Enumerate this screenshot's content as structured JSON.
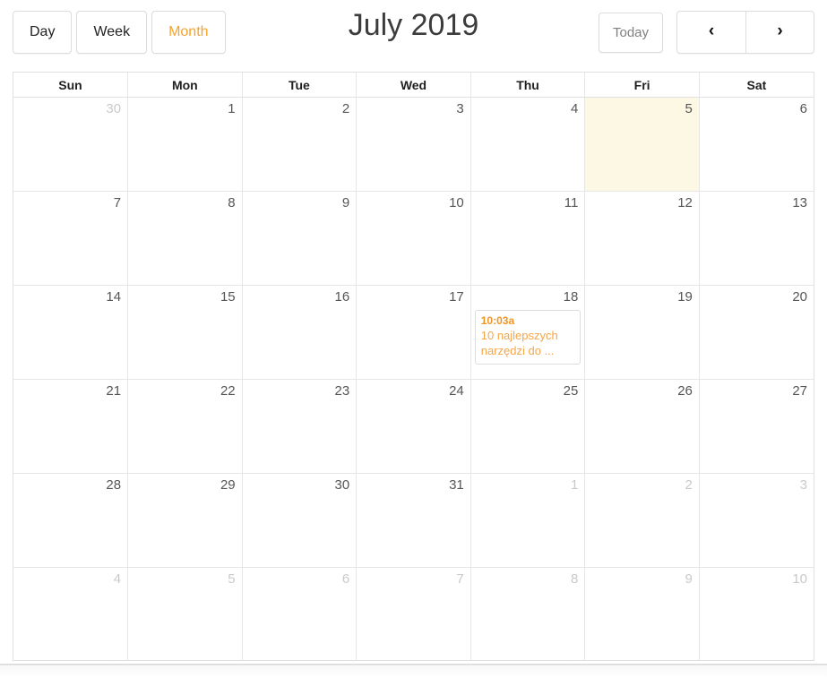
{
  "toolbar": {
    "views": [
      {
        "label": "Day",
        "state": "normal"
      },
      {
        "label": "Week",
        "state": "normal"
      },
      {
        "label": "Month",
        "state": "active"
      }
    ],
    "title": "July 2019",
    "today_label": "Today",
    "today_state": "disabled",
    "prev_icon": "chevron-left-icon",
    "prev_glyph": "‹",
    "next_icon": "chevron-right-icon",
    "next_glyph": "›"
  },
  "colors": {
    "accent": "#f6a32c",
    "event_time": "#ef9526",
    "event_title": "#f4a64a",
    "today_background": "#fcf8e3",
    "border": "#e0e0e0",
    "daynum": "#555555",
    "daynum_muted": "#c9c9c9"
  },
  "calendar": {
    "weekday_headers": [
      "Sun",
      "Mon",
      "Tue",
      "Wed",
      "Thu",
      "Fri",
      "Sat"
    ],
    "weeks": [
      [
        {
          "day": "30",
          "other_month": true
        },
        {
          "day": "1"
        },
        {
          "day": "2"
        },
        {
          "day": "3"
        },
        {
          "day": "4"
        },
        {
          "day": "5",
          "today": true
        },
        {
          "day": "6"
        }
      ],
      [
        {
          "day": "7"
        },
        {
          "day": "8"
        },
        {
          "day": "9"
        },
        {
          "day": "10"
        },
        {
          "day": "11"
        },
        {
          "day": "12"
        },
        {
          "day": "13"
        }
      ],
      [
        {
          "day": "14"
        },
        {
          "day": "15"
        },
        {
          "day": "16"
        },
        {
          "day": "17"
        },
        {
          "day": "18",
          "event": {
            "time": "10:03a",
            "title": "10 najlepszych narzędzi do ..."
          }
        },
        {
          "day": "19"
        },
        {
          "day": "20"
        }
      ],
      [
        {
          "day": "21"
        },
        {
          "day": "22"
        },
        {
          "day": "23"
        },
        {
          "day": "24"
        },
        {
          "day": "25"
        },
        {
          "day": "26"
        },
        {
          "day": "27"
        }
      ],
      [
        {
          "day": "28"
        },
        {
          "day": "29"
        },
        {
          "day": "30"
        },
        {
          "day": "31"
        },
        {
          "day": "1",
          "other_month": true
        },
        {
          "day": "2",
          "other_month": true
        },
        {
          "day": "3",
          "other_month": true
        }
      ],
      [
        {
          "day": "4",
          "other_month": true
        },
        {
          "day": "5",
          "other_month": true
        },
        {
          "day": "6",
          "other_month": true
        },
        {
          "day": "7",
          "other_month": true
        },
        {
          "day": "8",
          "other_month": true
        },
        {
          "day": "9",
          "other_month": true
        },
        {
          "day": "10",
          "other_month": true
        }
      ]
    ]
  }
}
